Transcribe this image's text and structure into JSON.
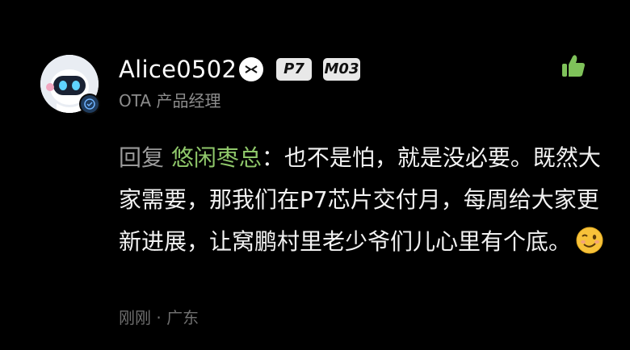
{
  "user": {
    "name": "Alice0502",
    "title": "OTA 产品经理",
    "tags": [
      "P7",
      "M03"
    ]
  },
  "comment": {
    "reply_prefix": "回复 ",
    "reply_to": "悠闲枣总",
    "text": "：也不是怕，就是没必要。既然大家需要，那我们在P7芯片交付月，每周给大家更新进展，让窝鹏村里老少爷们儿心里有个底。",
    "emoji": "winking-face"
  },
  "meta": {
    "time": "刚刚",
    "separator": " · ",
    "location": "广东"
  },
  "icons": {
    "like": "thumbs-up-icon",
    "brand": "xpeng-logo-icon"
  },
  "colors": {
    "background": "#000000",
    "reply_name": "#8fc76a",
    "like": "#7fc25a",
    "muted": "#8d8d8d"
  }
}
